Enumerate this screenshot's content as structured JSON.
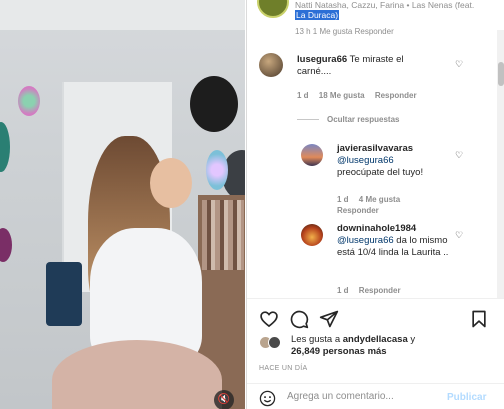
{
  "media": {
    "mute_glyph": "🔇"
  },
  "header": {
    "song_line": "Natti Natasha, Cazzu, Farina • Las Nenas (feat.",
    "song_highlight": "La Duraca)",
    "cut_meta": "13 h   1 Me gusta   Responder"
  },
  "comments": [
    {
      "user": "lusegura66",
      "text": "Te miraste el carné....",
      "time": "1 d",
      "likes": "18 Me gusta",
      "reply": "Responder"
    }
  ],
  "hide_replies": "Ocultar respuestas",
  "replies": [
    {
      "user": "javierasilvavaras",
      "mention": "@lusegura66",
      "text": "preocúpate del tuyo!",
      "time": "1 d",
      "likes": "4 Me gusta",
      "reply": "Responder"
    },
    {
      "user": "downinahole1984",
      "mention": "@lusegura66",
      "text": "da lo mismo está 10/4 linda la Laurita ..",
      "time": "1 d",
      "reply": "Responder"
    }
  ],
  "likes_line": {
    "prefix": "Les gusta a",
    "user": "andydellacasa",
    "mid": "y",
    "count": "26,849 personas más"
  },
  "time_ago": "HACE UN DÍA",
  "comment_input": {
    "placeholder": "Agrega un comentario..."
  },
  "post_label": "Publicar",
  "colors": {
    "link": "#00376b",
    "muted": "#8e8e8e",
    "post_disabled": "#b3dbff",
    "highlight": "#2b6fd6"
  }
}
